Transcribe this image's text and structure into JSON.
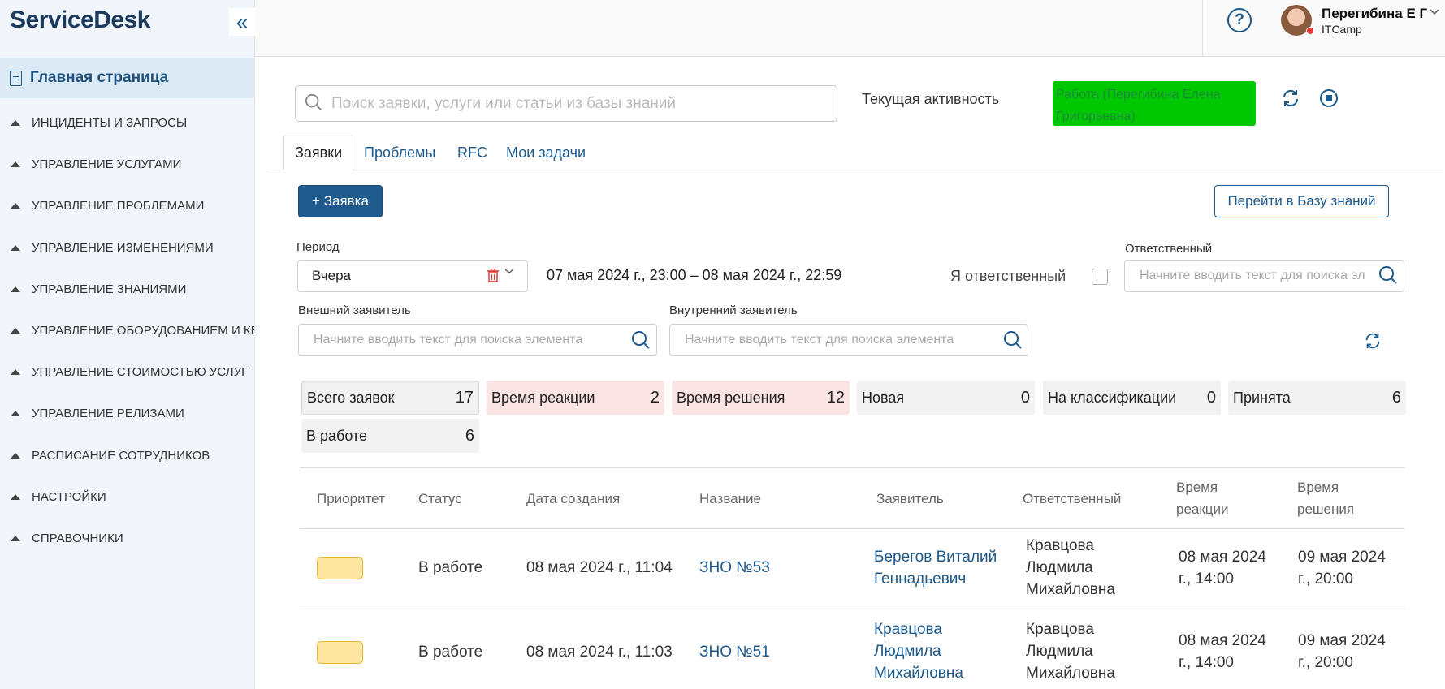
{
  "app": {
    "title": "ServiceDesk",
    "collapse_glyph": "«"
  },
  "sidebar": {
    "home_label": "Главная страница",
    "items": [
      {
        "label": "ИНЦИДЕНТЫ И ЗАПРОСЫ"
      },
      {
        "label": "УПРАВЛЕНИЕ УСЛУГАМИ"
      },
      {
        "label": "УПРАВЛЕНИЕ ПРОБЛЕМАМИ"
      },
      {
        "label": "УПРАВЛЕНИЕ ИЗМЕНЕНИЯМИ"
      },
      {
        "label": "УПРАВЛЕНИЕ ЗНАНИЯМИ"
      },
      {
        "label": "УПРАВЛЕНИЕ ОБОРУДОВАНИЕМ И КЕ"
      },
      {
        "label": "УПРАВЛЕНИЕ СТОИМОСТЬЮ УСЛУГ"
      },
      {
        "label": "УПРАВЛЕНИЕ РЕЛИЗАМИ"
      },
      {
        "label": "РАСПИСАНИЕ СОТРУДНИКОВ"
      },
      {
        "label": "НАСТРОЙКИ"
      },
      {
        "label": "СПРАВОЧНИКИ"
      }
    ]
  },
  "header": {
    "help_glyph": "?",
    "user_name": "Перегибина Е Г",
    "user_org": "ITCamp",
    "status_color": "#e53935"
  },
  "search": {
    "placeholder": "Поиск заявки, услуги или статьи из базы знаний"
  },
  "activity": {
    "label": "Текущая активность",
    "value": "Работа (Перегибина Елена Григорьевна)",
    "badge_color": "#00c800"
  },
  "tabs": [
    {
      "label": "Заявки",
      "active": true
    },
    {
      "label": "Проблемы"
    },
    {
      "label": "RFC"
    },
    {
      "label": "Мои задачи"
    }
  ],
  "actions": {
    "new_request": "+ Заявка",
    "knowledge_base": "Перейти в Базу знаний"
  },
  "filters": {
    "period_label": "Период",
    "period_value": "Вчера",
    "date_range": "07 мая 2024 г., 23:00 – 08 мая 2024 г., 22:59",
    "i_responsible_label": "Я ответственный",
    "responsible_label": "Ответственный",
    "responsible_placeholder": "Начните вводить текст для поиска эл",
    "external_label": "Внешний заявитель",
    "external_placeholder": "Начните вводить текст для поиска элемента",
    "internal_label": "Внутренний заявитель",
    "internal_placeholder": "Начните вводить текст для поиска элемента"
  },
  "counters": [
    {
      "label": "Всего заявок",
      "value": "17"
    },
    {
      "label": "Время реакции",
      "value": "2"
    },
    {
      "label": "Время решения",
      "value": "12"
    },
    {
      "label": "Новая",
      "value": "0"
    },
    {
      "label": "На классификации",
      "value": "0"
    },
    {
      "label": "Принята",
      "value": "6"
    },
    {
      "label": "В работе",
      "value": "6"
    }
  ],
  "table": {
    "columns": {
      "priority": "Приоритет",
      "status": "Статус",
      "created": "Дата создания",
      "name": "Название",
      "requester": "Заявитель",
      "responsible": "Ответственный",
      "reaction_1": "Время",
      "reaction_2": "реакции",
      "solution_1": "Время",
      "solution_2": "решения"
    },
    "rows": [
      {
        "priority_color": "#ffe6a0",
        "status": "В работе",
        "created": "08 мая 2024 г., 11:04",
        "name": "ЗНО №53",
        "requester_1": "Берегов Виталий",
        "requester_2": "Геннадьевич",
        "requester_3": "",
        "responsible_1": "Кравцова",
        "responsible_2": "Людмила",
        "responsible_3": "Михайловна",
        "reaction_1": "08 мая 2024",
        "reaction_2": "г., 14:00",
        "solution_1": "09 мая 2024",
        "solution_2": "г., 20:00"
      },
      {
        "priority_color": "#ffe6a0",
        "status": "В работе",
        "created": "08 мая 2024 г., 11:03",
        "name": "ЗНО №51",
        "requester_1": "Кравцова",
        "requester_2": "Людмила",
        "requester_3": "Михайловна",
        "responsible_1": "Кравцова",
        "responsible_2": "Людмила",
        "responsible_3": "Михайловна",
        "reaction_1": "08 мая 2024",
        "reaction_2": "г., 14:00",
        "solution_1": "09 мая 2024",
        "solution_2": "г., 20:00"
      }
    ]
  }
}
